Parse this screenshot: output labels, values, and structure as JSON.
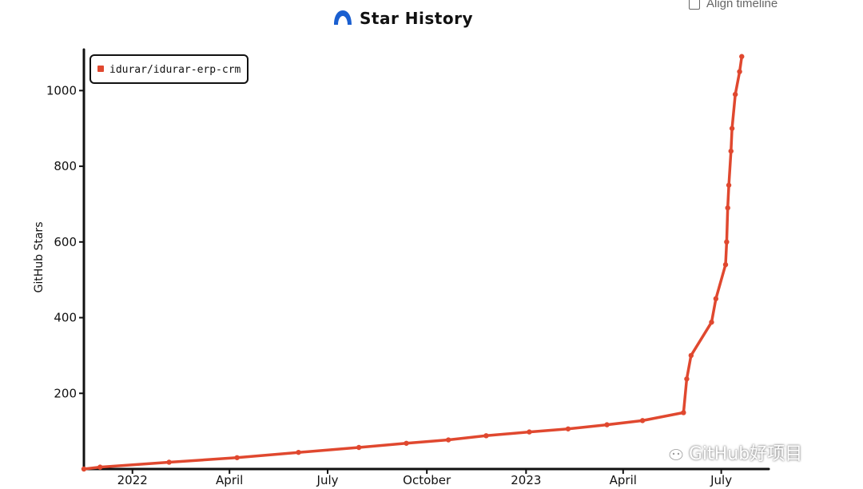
{
  "header": {
    "title": "Star History",
    "logo_icon": "star-history-logo-icon",
    "brand_color": "#1a5fd0"
  },
  "controls": {
    "align_timeline_label": "Align timeline",
    "align_timeline_checked": false
  },
  "watermark": {
    "text": "GitHub好项目",
    "icon": "wechat-icon"
  },
  "chart_data": {
    "type": "line",
    "title": "Star History",
    "xlabel": "",
    "ylabel": "GitHub Stars",
    "x_type": "date",
    "xlim": [
      "2021-11-17",
      "2023-08-14"
    ],
    "ylim": [
      0,
      1100
    ],
    "yticks": [
      200,
      400,
      600,
      800,
      1000
    ],
    "xticks": [
      {
        "date": "2022-01-01",
        "label": "2022"
      },
      {
        "date": "2022-04-01",
        "label": "April"
      },
      {
        "date": "2022-07-01",
        "label": "July"
      },
      {
        "date": "2022-10-01",
        "label": "October"
      },
      {
        "date": "2023-01-01",
        "label": "2023"
      },
      {
        "date": "2023-04-01",
        "label": "April"
      },
      {
        "date": "2023-07-01",
        "label": "July"
      }
    ],
    "legend": "top-left",
    "grid": false,
    "series": [
      {
        "name": "idurar/idurar-erp-crm",
        "color": "#e0482f",
        "points": [
          {
            "x": "2021-11-17",
            "y": 0
          },
          {
            "x": "2021-12-02",
            "y": 5
          },
          {
            "x": "2022-02-04",
            "y": 18
          },
          {
            "x": "2022-04-08",
            "y": 30
          },
          {
            "x": "2022-06-04",
            "y": 44
          },
          {
            "x": "2022-07-30",
            "y": 57
          },
          {
            "x": "2022-09-12",
            "y": 68
          },
          {
            "x": "2022-10-21",
            "y": 77
          },
          {
            "x": "2022-11-25",
            "y": 88
          },
          {
            "x": "2023-01-04",
            "y": 98
          },
          {
            "x": "2023-02-09",
            "y": 106
          },
          {
            "x": "2023-03-17",
            "y": 117
          },
          {
            "x": "2023-04-19",
            "y": 128
          },
          {
            "x": "2023-05-27",
            "y": 149
          },
          {
            "x": "2023-05-30",
            "y": 238
          },
          {
            "x": "2023-06-03",
            "y": 300
          },
          {
            "x": "2023-06-22",
            "y": 388
          },
          {
            "x": "2023-06-26",
            "y": 450
          },
          {
            "x": "2023-07-05",
            "y": 540
          },
          {
            "x": "2023-07-06",
            "y": 600
          },
          {
            "x": "2023-07-07",
            "y": 690
          },
          {
            "x": "2023-07-08",
            "y": 750
          },
          {
            "x": "2023-07-10",
            "y": 840
          },
          {
            "x": "2023-07-11",
            "y": 900
          },
          {
            "x": "2023-07-14",
            "y": 990
          },
          {
            "x": "2023-07-18",
            "y": 1050
          },
          {
            "x": "2023-07-20",
            "y": 1090
          }
        ]
      }
    ]
  }
}
